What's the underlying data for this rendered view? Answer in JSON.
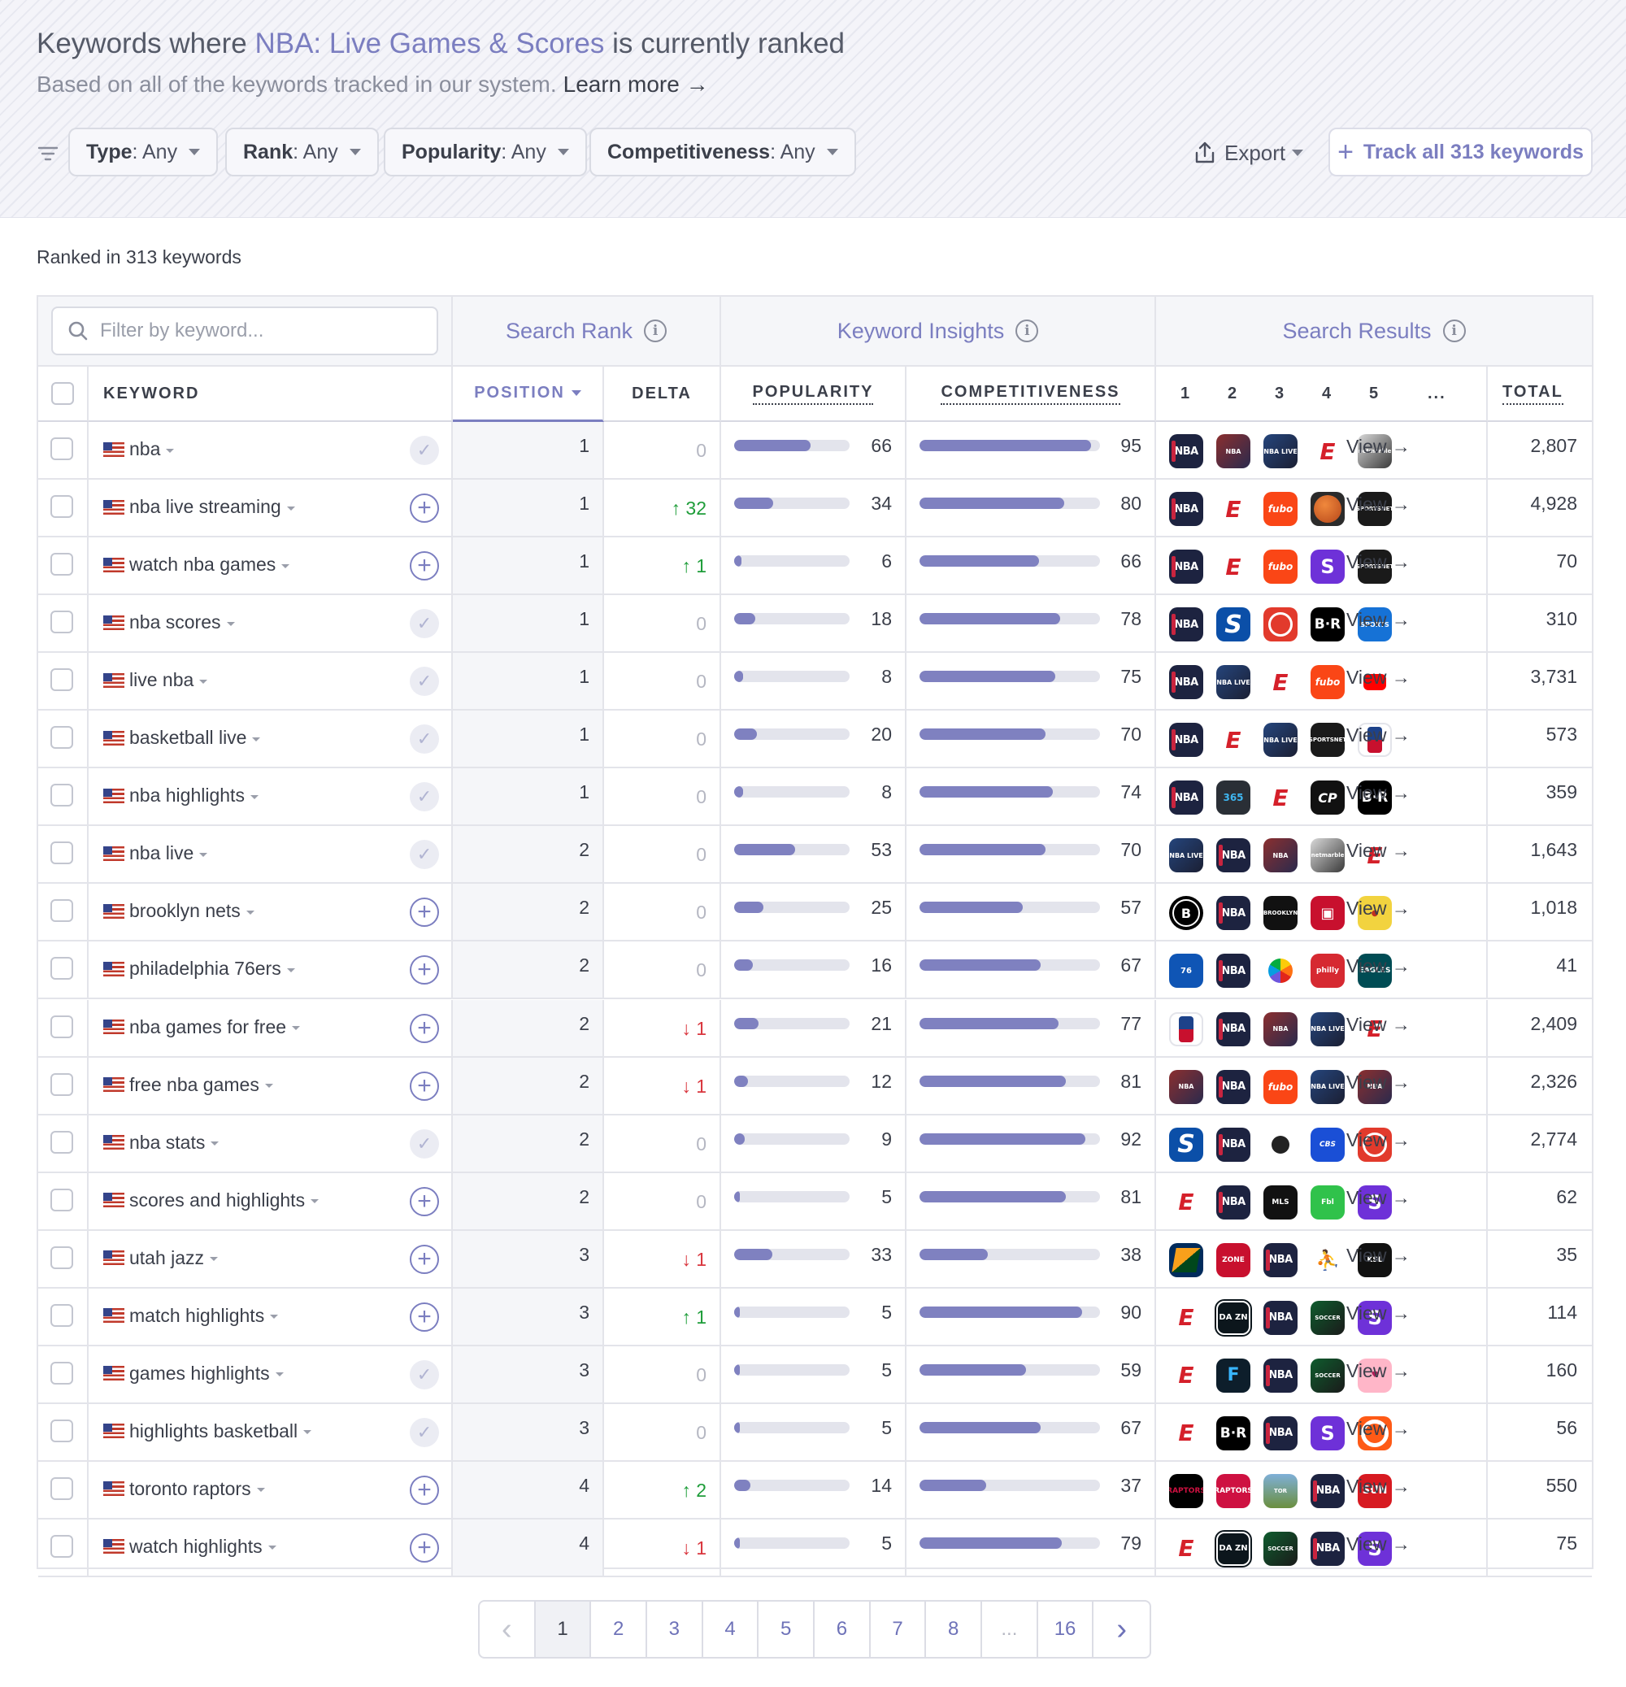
{
  "header": {
    "title_prefix": "Keywords where ",
    "app_name": "NBA: Live Games & Scores",
    "title_suffix": " is currently ranked",
    "subtitle": "Based on all of the keywords tracked in our system.",
    "learn_more": "Learn more →"
  },
  "filters": [
    {
      "label": "Type",
      "value": ": Any"
    },
    {
      "label": "Rank",
      "value": ": Any"
    },
    {
      "label": "Popularity",
      "value": ": Any"
    },
    {
      "label": "Competitiveness",
      "value": ": Any"
    }
  ],
  "export_label": "Export",
  "track_label": "Track all 313 keywords",
  "ranked_text": "Ranked in 313 keywords",
  "search": {
    "placeholder": "Filter by keyword..."
  },
  "groups": {
    "search_rank": "Search Rank",
    "keyword_insights": "Keyword Insights",
    "search_results": "Search Results"
  },
  "columns": {
    "keyword": "KEYWORD",
    "position": "POSITION",
    "delta": "DELTA",
    "popularity": "POPULARITY",
    "competitiveness": "COMPETITIVENESS",
    "r1": "1",
    "r2": "2",
    "r3": "3",
    "r4": "4",
    "r5": "5",
    "more": "...",
    "total": "TOTAL"
  },
  "view_label": "View →",
  "colors": {
    "accent": "#7b7ec0",
    "up": "#1f9d3a",
    "down": "#d9363e",
    "bar": "#7f81c0"
  },
  "rows": [
    {
      "keyword": "nba",
      "tracked": true,
      "position": "1",
      "delta": "0",
      "delta_dir": "none",
      "popularity": 66,
      "competitiveness": 95,
      "icons": [
        "nba",
        "game",
        "live",
        "espn",
        "netmarble"
      ],
      "total": "2,807"
    },
    {
      "keyword": "nba live streaming",
      "tracked": false,
      "position": "1",
      "delta": "32",
      "delta_dir": "up",
      "popularity": 34,
      "competitiveness": 80,
      "icons": [
        "nba",
        "espn",
        "fubo",
        "ball",
        "sportsnet"
      ],
      "total": "4,928"
    },
    {
      "keyword": "watch nba games",
      "tracked": false,
      "position": "1",
      "delta": "1",
      "delta_dir": "up",
      "popularity": 6,
      "competitiveness": 66,
      "icons": [
        "nba",
        "espn",
        "fubo",
        "yahoo",
        "sportsnet"
      ],
      "total": "70"
    },
    {
      "keyword": "nba scores",
      "tracked": true,
      "position": "1",
      "delta": "0",
      "delta_dir": "none",
      "popularity": 18,
      "competitiveness": 78,
      "icons": [
        "nba",
        "s-blue",
        "bball-red",
        "br",
        "cbs"
      ],
      "total": "310"
    },
    {
      "keyword": "live nba",
      "tracked": true,
      "position": "1",
      "delta": "0",
      "delta_dir": "none",
      "popularity": 8,
      "competitiveness": 75,
      "icons": [
        "nba",
        "live",
        "espn",
        "fubo",
        "yt"
      ],
      "total": "3,731"
    },
    {
      "keyword": "basketball live",
      "tracked": true,
      "position": "1",
      "delta": "0",
      "delta_dir": "none",
      "popularity": 20,
      "competitiveness": 70,
      "icons": [
        "nba",
        "espn",
        "live",
        "sportsnet",
        "nbaapp"
      ],
      "total": "573"
    },
    {
      "keyword": "nba highlights",
      "tracked": true,
      "position": "1",
      "delta": "0",
      "delta_dir": "none",
      "popularity": 8,
      "competitiveness": 74,
      "icons": [
        "nba",
        "score365",
        "espn",
        "cp",
        "br"
      ],
      "total": "359"
    },
    {
      "keyword": "nba live",
      "tracked": true,
      "position": "2",
      "delta": "0",
      "delta_dir": "none",
      "popularity": 53,
      "competitiveness": 70,
      "icons": [
        "live",
        "nba",
        "game",
        "netmarble",
        "espn"
      ],
      "total": "1,643"
    },
    {
      "keyword": "brooklyn nets",
      "tracked": false,
      "position": "2",
      "delta": "0",
      "delta_dir": "none",
      "popularity": 25,
      "competitiveness": 57,
      "icons": [
        "nets",
        "nba",
        "brooklyn",
        "arena",
        "yellow"
      ],
      "total": "1,018"
    },
    {
      "keyword": "philadelphia 76ers",
      "tracked": false,
      "position": "2",
      "delta": "0",
      "delta_dir": "none",
      "popularity": 16,
      "competitiveness": 67,
      "icons": [
        "sixers",
        "nba",
        "nbc",
        "philly",
        "eagles"
      ],
      "total": "41"
    },
    {
      "keyword": "nba games for free",
      "tracked": false,
      "position": "2",
      "delta": "1",
      "delta_dir": "down",
      "popularity": 21,
      "competitiveness": 77,
      "icons": [
        "nbaapp",
        "nba",
        "game",
        "live",
        "espn"
      ],
      "total": "2,409"
    },
    {
      "keyword": "free nba games",
      "tracked": false,
      "position": "2",
      "delta": "1",
      "delta_dir": "down",
      "popularity": 12,
      "competitiveness": 81,
      "icons": [
        "game",
        "nba",
        "fubo",
        "live",
        "game"
      ],
      "total": "2,326"
    },
    {
      "keyword": "nba stats",
      "tracked": true,
      "position": "2",
      "delta": "0",
      "delta_dir": "none",
      "popularity": 9,
      "competitiveness": 92,
      "icons": [
        "s-blue",
        "nba",
        "moon",
        "cbs2",
        "bball-red"
      ],
      "total": "2,774"
    },
    {
      "keyword": "scores and highlights",
      "tracked": false,
      "position": "2",
      "delta": "0",
      "delta_dir": "none",
      "popularity": 5,
      "competitiveness": 81,
      "icons": [
        "espn",
        "nba",
        "mls",
        "fbl",
        "yahoo"
      ],
      "total": "62"
    },
    {
      "keyword": "utah jazz",
      "tracked": false,
      "position": "3",
      "delta": "1",
      "delta_dir": "down",
      "popularity": 33,
      "competitiveness": 38,
      "icons": [
        "jazz",
        "zone",
        "nba",
        "runner",
        "ksl"
      ],
      "total": "35"
    },
    {
      "keyword": "match highlights",
      "tracked": false,
      "position": "3",
      "delta": "1",
      "delta_dir": "up",
      "popularity": 5,
      "competitiveness": 90,
      "icons": [
        "espn",
        "dazn",
        "nba",
        "soccer",
        "yahoo"
      ],
      "total": "114"
    },
    {
      "keyword": "games highlights",
      "tracked": true,
      "position": "3",
      "delta": "0",
      "delta_dir": "none",
      "popularity": 5,
      "competitiveness": 59,
      "icons": [
        "espn",
        "fotmob",
        "nba",
        "soccer",
        "pink"
      ],
      "total": "160"
    },
    {
      "keyword": "highlights basketball",
      "tracked": true,
      "position": "3",
      "delta": "0",
      "delta_dir": "none",
      "popularity": 5,
      "competitiveness": 67,
      "icons": [
        "espn",
        "br",
        "nba",
        "yahoo",
        "orange"
      ],
      "total": "56"
    },
    {
      "keyword": "toronto raptors",
      "tracked": false,
      "position": "4",
      "delta": "2",
      "delta_dir": "up",
      "popularity": 14,
      "competitiveness": 37,
      "icons": [
        "raptors2",
        "raptors",
        "photo",
        "nba",
        "sun"
      ],
      "total": "550"
    },
    {
      "keyword": "watch highlights",
      "tracked": false,
      "position": "4",
      "delta": "1",
      "delta_dir": "down",
      "popularity": 5,
      "competitiveness": 79,
      "icons": [
        "espn",
        "dazn",
        "soccer",
        "nba",
        "yahoo"
      ],
      "total": "75"
    }
  ],
  "icon_text": {
    "nba": "NBA",
    "espn": "E",
    "fubo": "fubo",
    "sportsnet": "SPORTSNET",
    "game": "NBA",
    "live": "NBA LIVE",
    "netmarble": "netmarble",
    "s-blue": "S",
    "br": "B·R",
    "cbs": "SPORTS",
    "cp": "CP",
    "score365": "365",
    "brooklyn": "BROOKLYN",
    "arena": "▣",
    "yellow": "●",
    "sixers": "76",
    "philly": "philly",
    "eagles": "EAGLES",
    "cbs2": "CBS",
    "mls": "MLS",
    "fbl": "Fbl",
    "yahoo": "S",
    "zone": "ZONE",
    "runner": "⛹",
    "ksl": "KSL",
    "dazn": "DA ZN",
    "soccer": "SOCCER",
    "fotmob": "F",
    "pink": "♥",
    "raptors": "RAPTORS",
    "raptors2": "RAPTORS",
    "photo": "TOR",
    "sun": "SUN"
  },
  "pagination": {
    "pages": [
      "1",
      "2",
      "3",
      "4",
      "5",
      "6",
      "7",
      "8",
      "...",
      "16"
    ],
    "active": "1",
    "prev": "‹",
    "next": "›"
  }
}
